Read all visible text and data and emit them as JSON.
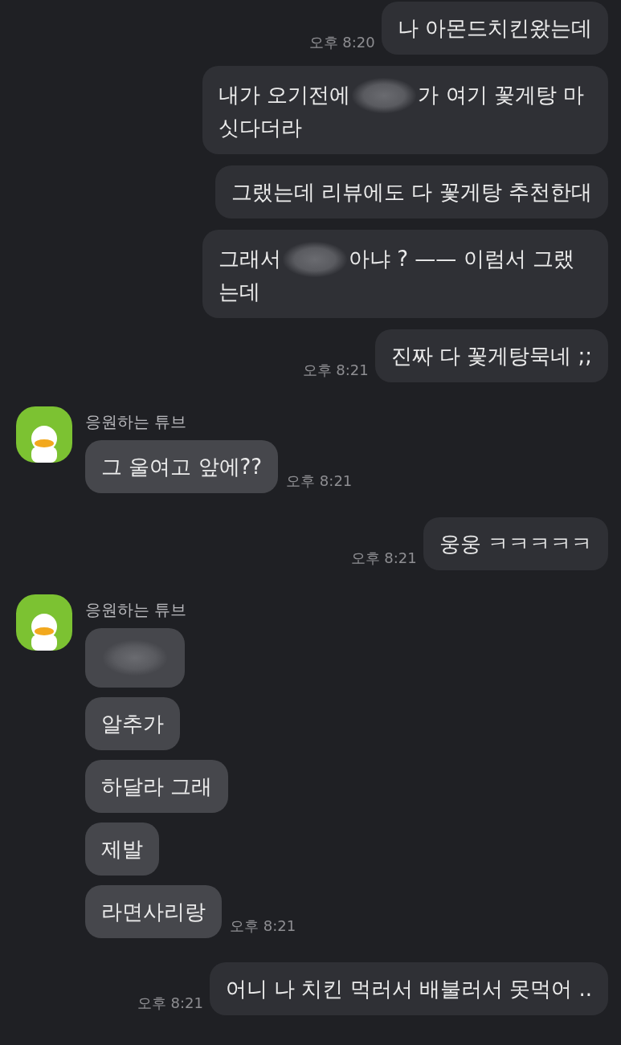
{
  "groups": [
    {
      "kind": "sent",
      "messages": [
        {
          "parts": [
            {
              "kind": "text",
              "text": "나 아몬드치킨왔는데"
            }
          ],
          "time": "오후 8:20"
        },
        {
          "parts": [
            {
              "kind": "text",
              "text": "내가 오기전에"
            },
            {
              "kind": "blur"
            },
            {
              "kind": "text",
              "text": "가 여기 꽃게탕 마싯다더라"
            }
          ]
        },
        {
          "parts": [
            {
              "kind": "text",
              "text": "그랬는데 리뷰에도 다 꽃게탕 추천한대"
            }
          ]
        },
        {
          "parts": [
            {
              "kind": "text",
              "text": "그래서"
            },
            {
              "kind": "blur"
            },
            {
              "kind": "text",
              "text": "아냐 ? —— 이럼서 그랬는데"
            }
          ]
        },
        {
          "parts": [
            {
              "kind": "text",
              "text": "진짜 다 꽃게탕묵네 ;;"
            }
          ],
          "time": "오후 8:21"
        }
      ]
    },
    {
      "kind": "received",
      "sender": "응원하는 튜브",
      "messages": [
        {
          "parts": [
            {
              "kind": "text",
              "text": "그 울여고 앞에??"
            }
          ],
          "time": "오후 8:21"
        }
      ]
    },
    {
      "kind": "sent",
      "messages": [
        {
          "parts": [
            {
              "kind": "text",
              "text": "웅웅 ㅋㅋㅋㅋㅋ"
            }
          ],
          "time": "오후 8:21"
        }
      ]
    },
    {
      "kind": "received",
      "sender": "응원하는 튜브",
      "messages": [
        {
          "parts": [
            {
              "kind": "blur"
            }
          ]
        },
        {
          "parts": [
            {
              "kind": "text",
              "text": "알추가"
            }
          ]
        },
        {
          "parts": [
            {
              "kind": "text",
              "text": "하달라 그래"
            }
          ]
        },
        {
          "parts": [
            {
              "kind": "text",
              "text": "제발"
            }
          ]
        },
        {
          "parts": [
            {
              "kind": "text",
              "text": "라면사리랑"
            }
          ],
          "time": "오후 8:21"
        }
      ]
    },
    {
      "kind": "sent",
      "messages": [
        {
          "parts": [
            {
              "kind": "text",
              "text": "어니 나 치킨 먹러서 배불러서 못먹어 .."
            }
          ],
          "time": "오후 8:21"
        }
      ]
    }
  ]
}
